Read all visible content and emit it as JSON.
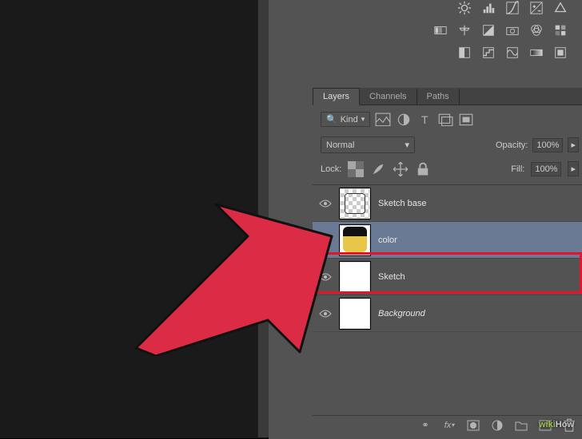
{
  "tabs": {
    "layers": "Layers",
    "channels": "Channels",
    "paths": "Paths"
  },
  "filter": {
    "kind": "Kind"
  },
  "blend": {
    "mode": "Normal",
    "opacity_label": "Opacity:",
    "opacity_value": "100%"
  },
  "lock": {
    "label": "Lock:",
    "fill_label": "Fill:",
    "fill_value": "100%"
  },
  "layers": [
    {
      "name": "Sketch base",
      "thumb": "check-sketch"
    },
    {
      "name": "color",
      "thumb": "face",
      "selected": true
    },
    {
      "name": "Sketch",
      "thumb": "white"
    },
    {
      "name": "Background",
      "thumb": "white",
      "ital": true
    }
  ],
  "watermark": {
    "brand_pre": "wiki",
    "brand_post": "How"
  }
}
